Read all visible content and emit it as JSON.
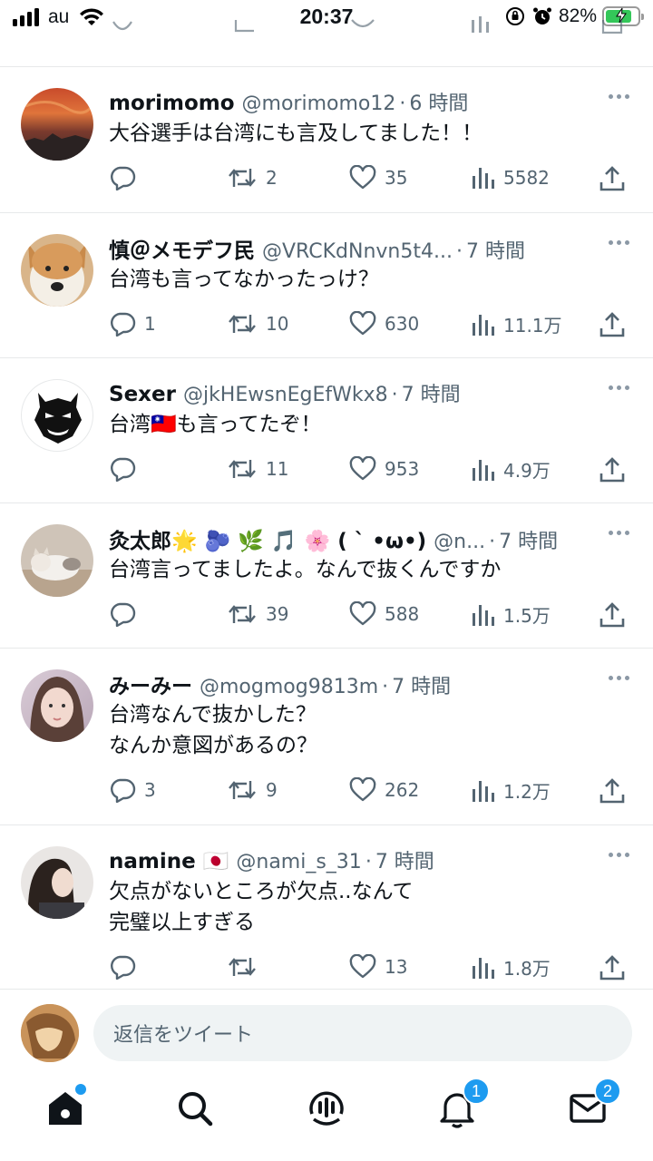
{
  "status": {
    "carrier": "au",
    "time": "20:37",
    "battery": "82%",
    "battery_level": 0.82
  },
  "tweets": [
    {
      "name": "morimomo",
      "handle": "@morimomo12",
      "time": "6 時間",
      "text": "大谷選手は台湾にも言及してました！！",
      "replies": "",
      "retweets": "2",
      "likes": "35",
      "views": "5582"
    },
    {
      "name": "慎＠メモデフ民",
      "handle": "@VRCKdNnvn5t4...",
      "time": "7 時間",
      "text": "台湾も言ってなかったっけ？",
      "replies": "1",
      "retweets": "10",
      "likes": "630",
      "views": "11.1万"
    },
    {
      "name": "Sexer",
      "handle": "@jkHEwsnEgEfWkx8",
      "time": "7 時間",
      "text": "台湾🇹🇼も言ってたぞ！",
      "replies": "",
      "retweets": "11",
      "likes": "953",
      "views": "4.9万"
    },
    {
      "name": "灸太郎🌟 🫐 🌿 🎵 🌸 ( ˋ •ω•)",
      "handle": "@n...",
      "time": "7 時間",
      "text": "台湾言ってましたよ。なんで抜くんですか",
      "replies": "",
      "retweets": "39",
      "likes": "588",
      "views": "1.5万"
    },
    {
      "name": "みーみー",
      "handle": "@mogmog9813m",
      "time": "7 時間",
      "text": "台湾なんで抜かした？\nなんか意図があるの？",
      "replies": "3",
      "retweets": "9",
      "likes": "262",
      "views": "1.2万"
    },
    {
      "name": "namine 🇯🇵",
      "handle": "@nami_s_31",
      "time": "7 時間",
      "text": "欠点がないところが欠点..なんて\n完璧以上すぎる",
      "replies": "",
      "retweets": "",
      "likes": "13",
      "views": "1.8万"
    }
  ],
  "reply_bar": {
    "placeholder": "返信をツイート"
  },
  "tabbar": {
    "notifications_badge": "1",
    "messages_badge": "2"
  },
  "colors": {
    "accent": "#1d9bf0",
    "secondary_text": "#536471",
    "divider": "#e7e9ea"
  },
  "icons": [
    "reply-icon",
    "retweet-icon",
    "like-icon",
    "views-icon",
    "share-icon",
    "home-icon",
    "search-icon",
    "spaces-icon",
    "notifications-icon",
    "messages-icon"
  ]
}
